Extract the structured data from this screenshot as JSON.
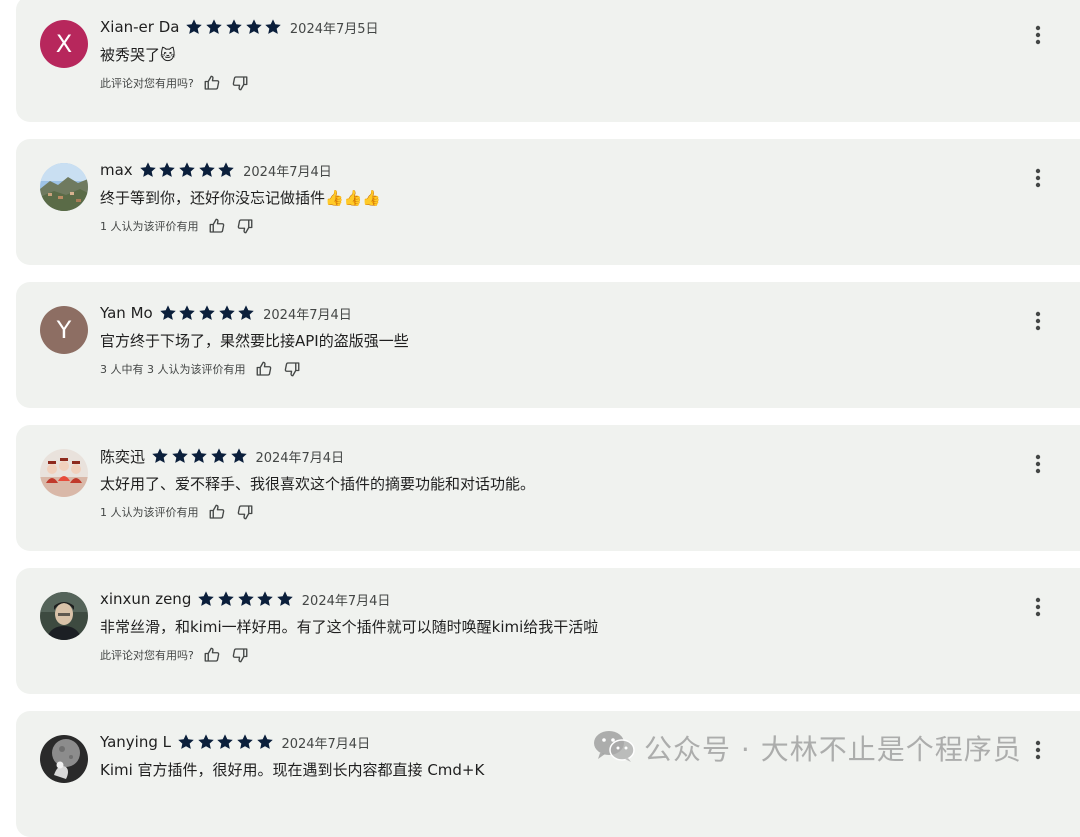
{
  "reviews": [
    {
      "name": "Xian-er Da",
      "avatar_type": "letter",
      "avatar_letter": "X",
      "avatar_color": "#b7275c",
      "rating": 5,
      "date": "2024年7月5日",
      "text": "被秀哭了🐱",
      "helpful_text": "此评论对您有用吗?"
    },
    {
      "name": "max",
      "avatar_type": "photo",
      "avatar_icon": "landscape-photo-icon",
      "rating": 5,
      "date": "2024年7月4日",
      "text": "终于等到你，还好你没忘记做插件👍👍👍",
      "helpful_text": "1 人认为该评价有用"
    },
    {
      "name": "Yan Mo",
      "avatar_type": "letter",
      "avatar_letter": "Y",
      "avatar_color": "#8d6e63",
      "rating": 5,
      "date": "2024年7月4日",
      "text": "官方终于下场了，果然要比接API的盗版强一些",
      "helpful_text": "3 人中有 3 人认为该评价有用"
    },
    {
      "name": "陈奕迅",
      "avatar_type": "photo",
      "avatar_icon": "group-photo-icon",
      "rating": 5,
      "date": "2024年7月4日",
      "text": "太好用了、爱不释手、我很喜欢这个插件的摘要功能和对话功能。",
      "helpful_text": "1 人认为该评价有用"
    },
    {
      "name": "xinxun zeng",
      "avatar_type": "photo",
      "avatar_icon": "portrait-photo-icon",
      "rating": 5,
      "date": "2024年7月4日",
      "text": "非常丝滑，和kimi一样好用。有了这个插件就可以随时唤醒kimi给我干活啦",
      "helpful_text": "此评论对您有用吗?"
    },
    {
      "name": "Yanying L",
      "avatar_type": "photo",
      "avatar_icon": "moon-photo-icon",
      "rating": 5,
      "date": "2024年7月4日",
      "text": "Kimi 官方插件，很好用。现在遇到长内容都直接 Cmd+K",
      "helpful_text": ""
    }
  ],
  "icons": {
    "star": "star-icon",
    "thumb_up": "thumb-up-icon",
    "thumb_down": "thumb-down-icon",
    "menu": "more-vert-icon"
  },
  "watermark": {
    "text": "公众号 · 大林不止是个程序员",
    "icon": "wechat-icon"
  },
  "colors": {
    "card_background": "#f0f2ef",
    "star": "#0b1f3b",
    "text": "#1f1f1f",
    "secondary_text": "#444746"
  }
}
